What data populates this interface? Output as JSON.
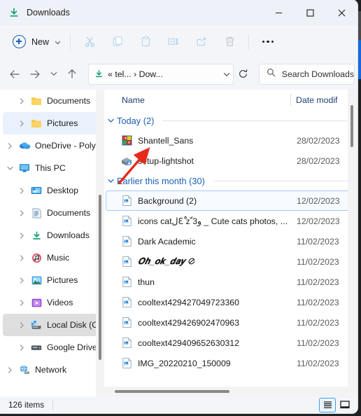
{
  "window": {
    "title": "Downloads",
    "title_icon": "download-icon",
    "minimize_label": "Minimize",
    "maximize_label": "Maximize",
    "close_label": "Close"
  },
  "toolbar": {
    "new_label": "New",
    "new_icon": "plus-circle-icon",
    "new_chevron_icon": "chevron-down-icon",
    "items": [
      {
        "name": "cut-button",
        "icon": "scissors-icon",
        "label": "Cut",
        "disabled": true
      },
      {
        "name": "copy-button",
        "icon": "copy-icon",
        "label": "Copy",
        "disabled": true
      },
      {
        "name": "paste-button",
        "icon": "clipboard-icon",
        "label": "Paste",
        "disabled": true
      },
      {
        "name": "rename-button",
        "icon": "rename-icon",
        "label": "Rename",
        "disabled": true
      },
      {
        "name": "share-button",
        "icon": "share-icon",
        "label": "Share",
        "disabled": true
      },
      {
        "name": "delete-button",
        "icon": "trash-icon",
        "label": "Delete",
        "disabled": true
      }
    ],
    "more_label": "See more",
    "more_icon": "ellipsis-icon"
  },
  "address": {
    "back_icon": "arrow-left-icon",
    "forward_icon": "arrow-right-icon",
    "recent_icon": "chevron-down-icon",
    "up_icon": "arrow-up-icon",
    "crumb_icon": "download-icon",
    "breadcrumb": "« tel... › Dow...",
    "crumb_chevron_icon": "chevron-down-icon",
    "refresh_icon": "refresh-icon",
    "search_icon": "search-icon",
    "search_placeholder": "Search Downloads",
    "search_value": ""
  },
  "sidebar": {
    "items": [
      {
        "label": "Documents",
        "icon": "folder-icon",
        "indent": 2,
        "state": "normal",
        "chevron": "right"
      },
      {
        "label": "Pictures",
        "icon": "folder-icon",
        "indent": 2,
        "state": "selected",
        "chevron": "right"
      },
      {
        "label": "OneDrive - Polyt",
        "icon": "onedrive-icon",
        "indent": 1,
        "state": "normal",
        "chevron": "right"
      },
      {
        "label": "This PC",
        "icon": "pc-icon",
        "indent": 1,
        "state": "normal",
        "chevron": "down"
      },
      {
        "label": "Desktop",
        "icon": "desktop-icon",
        "indent": 2,
        "state": "normal",
        "chevron": "right"
      },
      {
        "label": "Documents",
        "icon": "documents-icon",
        "indent": 2,
        "state": "normal",
        "chevron": "right"
      },
      {
        "label": "Downloads",
        "icon": "download-icon",
        "indent": 2,
        "state": "normal",
        "chevron": "right"
      },
      {
        "label": "Music",
        "icon": "music-icon",
        "indent": 2,
        "state": "normal",
        "chevron": "right"
      },
      {
        "label": "Pictures",
        "icon": "pictures-icon",
        "indent": 2,
        "state": "normal",
        "chevron": "right"
      },
      {
        "label": "Videos",
        "icon": "videos-icon",
        "indent": 2,
        "state": "normal",
        "chevron": "right"
      },
      {
        "label": "Local Disk (C:)",
        "icon": "disk-icon",
        "indent": 2,
        "state": "hover",
        "chevron": "right"
      },
      {
        "label": "Google Drive (G",
        "icon": "drive-icon",
        "indent": 2,
        "state": "normal",
        "chevron": "right"
      },
      {
        "label": "Network",
        "icon": "network-icon",
        "indent": 1,
        "state": "normal",
        "chevron": "right"
      }
    ]
  },
  "filelist": {
    "columns": {
      "name": "Name",
      "date": "Date modif"
    },
    "groups": [
      {
        "header": "Today (2)",
        "chevron_icon": "chevron-down-icon",
        "rows": [
          {
            "name": "Shantell_Sans",
            "date": "28/02/2023",
            "icon": "winrar-archive-icon",
            "state": "normal",
            "fancy": false
          },
          {
            "name": "setup-lightshot",
            "date": "28/02/2023",
            "icon": "installer-icon",
            "state": "normal",
            "fancy": false
          }
        ]
      },
      {
        "header": "Earlier this month (30)",
        "chevron_icon": "chevron-down-icon",
        "rows": [
          {
            "name": "Background (2)",
            "date": "12/02/2023",
            "icon": "image-file-icon",
            "state": "focus",
            "fancy": false
          },
          {
            "name": "icons catلƐْْ ᴢ ّْ3و _ Cute cats photos, ...",
            "date": "12/02/2023",
            "icon": "image-file-icon",
            "state": "normal",
            "fancy": false
          },
          {
            "name": "Dark Academic",
            "date": "11/02/2023",
            "icon": "image-file-icon",
            "state": "normal",
            "fancy": false
          },
          {
            "name": "𝑶𝒉_𝒐𝒌_𝒅𝒂𝒚 ⊘",
            "date": "11/02/2023",
            "icon": "image-file-icon",
            "state": "normal",
            "fancy": true
          },
          {
            "name": "thun",
            "date": "11/02/2023",
            "icon": "image-file-icon",
            "state": "normal",
            "fancy": false
          },
          {
            "name": "cooltext429427049723360",
            "date": "11/02/2023",
            "icon": "image-file-icon",
            "state": "normal",
            "fancy": false
          },
          {
            "name": "cooltext429426902470963",
            "date": "11/02/2023",
            "icon": "image-file-icon",
            "state": "normal",
            "fancy": false
          },
          {
            "name": "cooltext429409652630312",
            "date": "11/02/2023",
            "icon": "image-file-icon",
            "state": "normal",
            "fancy": false
          },
          {
            "name": "IMG_20220210_150009",
            "date": "11/02/2023",
            "icon": "image-file-icon",
            "state": "normal",
            "fancy": false
          }
        ]
      }
    ]
  },
  "statusbar": {
    "item_count": "126 items",
    "details_view_label": "Details view",
    "large_icons_view_label": "Large icons view",
    "active_view": "details"
  },
  "annotation": {
    "type": "arrow",
    "color": "#e8291c",
    "points_to": "Shantell_Sans"
  },
  "colors": {
    "accent": "#1b5fb3",
    "selected_bg": "#e8f1fc",
    "hover_bg": "#dedede",
    "chrome_bg": "#f3f5f9",
    "annotation_red": "#e8291c"
  }
}
